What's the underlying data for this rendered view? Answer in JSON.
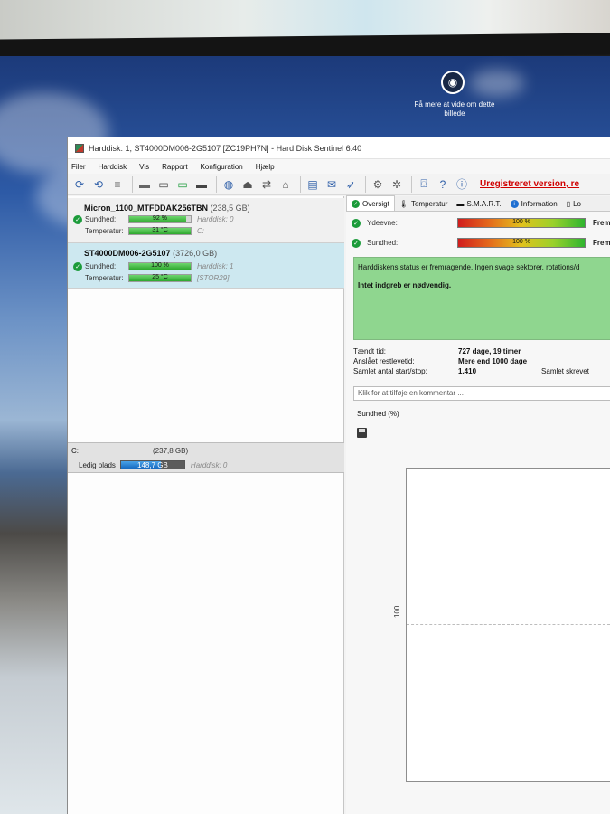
{
  "desktop": {
    "spotlight_text": "Få mere at vide om dette billede",
    "spotlight_icon": "camera-lens-icon"
  },
  "window": {
    "title": "Harddisk: 1, ST4000DM006-2G5107 [ZC19PH7N]  -  Hard Disk Sentinel 6.40"
  },
  "menu": {
    "items": [
      "Filer",
      "Harddisk",
      "Vis",
      "Rapport",
      "Konfiguration",
      "Hjælp"
    ]
  },
  "toolbar": {
    "icons": [
      "refresh-icon",
      "refresh-all-icon",
      "list-icon",
      "disk-icon",
      "disk-test-icon",
      "disk-ok-icon",
      "disk-remove-icon",
      "globe-icon",
      "eject-icon",
      "transfer-icon",
      "network-icon",
      "report-icon",
      "mail-icon",
      "send-icon",
      "gear-icon",
      "settings-icon",
      "camera-icon",
      "help-icon",
      "info-icon"
    ],
    "unregistered": "Uregistreret version, re"
  },
  "disks": [
    {
      "name": "Micron_1100_MTFDDAK256TBN",
      "size": "(238,5 GB)",
      "health_label": "Sundhed:",
      "health_value": "92 %",
      "health_pct": 92,
      "health_aux": "Harddisk: 0",
      "temp_label": "Temperatur:",
      "temp_value": "31 °C",
      "temp_pct": 100,
      "temp_aux": "C:"
    },
    {
      "name": "ST4000DM006-2G5107",
      "size": "(3726,0 GB)",
      "health_label": "Sundhed:",
      "health_value": "100 %",
      "health_pct": 100,
      "health_aux": "Harddisk: 1",
      "temp_label": "Temperatur:",
      "temp_value": "25 °C",
      "temp_pct": 100,
      "temp_aux": "[STOR29]"
    }
  ],
  "volume": {
    "name": "C:",
    "size": "(237,8 GB)",
    "free_label": "Ledig plads",
    "free_value": "148,7 GB",
    "free_fraction": 0.625,
    "disk_label": "Harddisk: 0"
  },
  "tabs": [
    {
      "label": "Oversigt",
      "icon": "check-icon"
    },
    {
      "label": "Temperatur",
      "icon": "thermometer-icon"
    },
    {
      "label": "S.M.A.R.T.",
      "icon": "dash-icon"
    },
    {
      "label": "Information",
      "icon": "info-icon"
    },
    {
      "label": "Lo",
      "icon": "document-icon"
    }
  ],
  "overview": {
    "performance_label": "Ydeevne:",
    "performance_value": "100 %",
    "health_label": "Sundhed:",
    "health_value": "100 %",
    "bar_right_label": "Fremra",
    "status_text": "Harddiskens status er fremragende. Ingen svage sektorer, rotations/d",
    "action_text": "Intet indgreb er nødvendig.",
    "powered_on_label": "Tændt tid:",
    "powered_on_value": "727 dage, 19 timer",
    "remaining_label": "Anslået restlevetid:",
    "remaining_value": "Mere end 1000 dage",
    "startstop_label": "Samlet antal start/stop:",
    "startstop_value": "1.410",
    "written_label": "Samlet skrevet",
    "comment_placeholder": "Klik for at tilføje en kommentar ..."
  },
  "chart_data": {
    "type": "line",
    "title": "Sundhed (%)",
    "y_ticks": [
      "100"
    ],
    "series": [],
    "grid": true
  }
}
